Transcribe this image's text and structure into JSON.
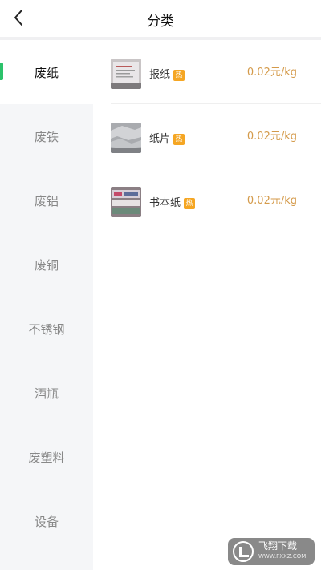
{
  "header": {
    "title": "分类"
  },
  "sidebar": {
    "items": [
      {
        "label": "废纸",
        "active": true
      },
      {
        "label": "废铁",
        "active": false
      },
      {
        "label": "废铝",
        "active": false
      },
      {
        "label": "废铜",
        "active": false
      },
      {
        "label": "不锈钢",
        "active": false
      },
      {
        "label": "酒瓶",
        "active": false
      },
      {
        "label": "废塑料",
        "active": false
      },
      {
        "label": "设备",
        "active": false
      }
    ]
  },
  "products": [
    {
      "name": "报纸",
      "hot_label": "热",
      "price": "0.02元/kg"
    },
    {
      "name": "纸片",
      "hot_label": "热",
      "price": "0.02元/kg"
    },
    {
      "name": "书本纸",
      "hot_label": "热",
      "price": "0.02元/kg"
    }
  ],
  "watermark": {
    "name": "飞翔下载",
    "url": "WWW.FXXZ.COM"
  },
  "colors": {
    "accent": "#2cc26b",
    "price": "#d49a4a",
    "hot_badge": "#f5a623"
  }
}
